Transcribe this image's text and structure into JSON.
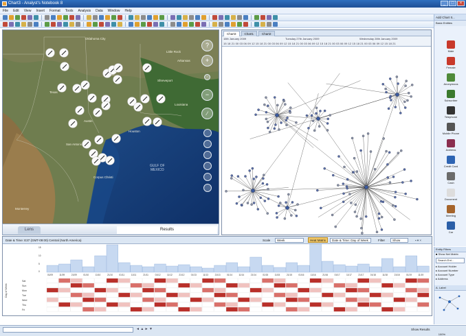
{
  "window": {
    "title": "Chart3 - Analyst's Notebook 8",
    "controls": [
      "_",
      "□",
      "×"
    ]
  },
  "menu": [
    "File",
    "Edit",
    "View",
    "Insert",
    "Format",
    "Tools",
    "Analysis",
    "Data",
    "Window",
    "Help"
  ],
  "map": {
    "labels": [
      {
        "text": "Oklahoma City"
      },
      {
        "text": "Little Rock"
      },
      {
        "text": "Arkansas"
      },
      {
        "text": "Dallas"
      },
      {
        "text": "Shreveport"
      },
      {
        "text": "Texas"
      },
      {
        "text": "Louisiana"
      },
      {
        "text": "Austin"
      },
      {
        "text": "Houston"
      },
      {
        "text": "San Antonio"
      },
      {
        "text": "Corpus Christi"
      },
      {
        "text": "Monterrey"
      }
    ],
    "gulf_label": [
      "GULF OF",
      "MEXICO"
    ],
    "tabs": {
      "lens": "Lens",
      "results": "Results"
    }
  },
  "chart": {
    "tabs": [
      "Chart3",
      "Chart1",
      "Chart2"
    ],
    "timeline_dates": [
      "16th January 2009",
      "Tuesday 27th January 2009",
      "Wednesday 28th January 2009"
    ],
    "timeline_hours": "15 18 21 00 03 06 09 12 15 18 21 00 03 06 09 12 15 18 21 00 03 06 09 12 15 18 21 00 03 06 09 12 15 18 21 00 03 06 09 12 15 18 21"
  },
  "right_panel": {
    "header": "Add Chart It...",
    "section": "Basic Entities",
    "items": [
      {
        "label": "Male",
        "color": "#c8392b"
      },
      {
        "label": "Female",
        "color": "#c8392b"
      },
      {
        "label": "Anonymous",
        "color": "#4e8a3a"
      },
      {
        "label": "Subscriber",
        "color": "#3b7a2e"
      },
      {
        "label": "Telephone",
        "color": "#333333"
      },
      {
        "label": "Mobile Phone",
        "color": "#555555"
      },
      {
        "label": "Address",
        "color": "#8b2e4f"
      },
      {
        "label": "Credit Card",
        "color": "#2d64b3"
      },
      {
        "label": "Cash",
        "color": "#6b6b6b"
      },
      {
        "label": "Document",
        "color": "#dddddd"
      },
      {
        "label": "Meeting",
        "color": "#a5642c"
      },
      {
        "label": "Car",
        "color": "#2b5fa8"
      }
    ]
  },
  "bottom": {
    "header": "Date & Time: E37 (GMT-09:00) Central (North America)",
    "scale_label": "Scale",
    "scale_value": "Week",
    "heatmap_label": "Heat Matrix",
    "date_label": "Date & Time: Day of Week",
    "rows_label": "Day of Week",
    "rows": [
      "Sat",
      "Sun",
      "Mon",
      "Tue",
      "Wed",
      "Thu",
      "Fri"
    ],
    "filter_label": "Filter",
    "filter_value": "Show",
    "week_labels": [
      "01/09",
      "11/09",
      "21/09",
      "01/10",
      "11/10",
      "21/10",
      "01/11",
      "11/11",
      "21/11",
      "01/12",
      "11/12",
      "21/12",
      "01/13",
      "11/13",
      "21/13",
      "01/14",
      "11/14",
      "21/14",
      "01/15",
      "11/15",
      "21/15",
      "01/16",
      "11/16",
      "21/16",
      "01/17",
      "11/17",
      "21/17",
      "01/18",
      "11/18",
      "21/18",
      "01/19",
      "11/19"
    ]
  },
  "lower_right": {
    "header": "Entity Filters",
    "items": [
      "Show Net Matrix",
      "Search Ent...",
      "Account Holder",
      "Account Number",
      "Account Type",
      "Address"
    ],
    "label_header": "A. Label"
  },
  "status": {
    "results": "Show Results",
    "zoom": "100%",
    "nav": "◄ ▲ ► ▼"
  }
}
